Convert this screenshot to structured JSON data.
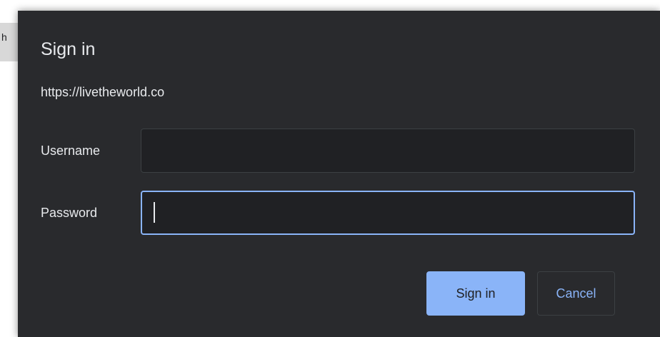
{
  "background": {
    "partial_text": "h"
  },
  "dialog": {
    "title": "Sign in",
    "origin": "https://livetheworld.co",
    "username_label": "Username",
    "username_value": "",
    "password_label": "Password",
    "password_value": "",
    "sign_in_label": "Sign in",
    "cancel_label": "Cancel"
  },
  "colors": {
    "dialog_bg": "#292a2d",
    "input_bg": "#202124",
    "text": "#e8eaed",
    "accent": "#8ab4f8"
  }
}
